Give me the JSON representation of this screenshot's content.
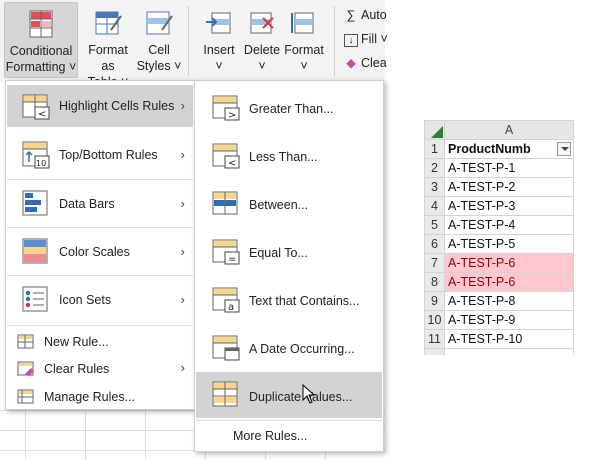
{
  "ribbon": {
    "buttons": [
      {
        "label": "Conditional Formatting",
        "icon": "conditional-formatting-icon",
        "pressed": true
      },
      {
        "label": "Format as Table",
        "icon": "format-as-table-icon"
      },
      {
        "label": "Cell Styles",
        "icon": "cell-styles-icon"
      },
      {
        "label": "Insert",
        "icon": "insert-cells-icon"
      },
      {
        "label": "Delete",
        "icon": "delete-cells-icon"
      },
      {
        "label": "Format",
        "icon": "format-cells-icon"
      }
    ],
    "editing": {
      "autosum": "Auto",
      "fill": "Fill",
      "clear": "Clea"
    }
  },
  "menu1": {
    "items": [
      {
        "label": "Highlight Cells Rules",
        "icon": "highlight-cells-icon",
        "highlighted": true,
        "submenu": true
      },
      {
        "label": "Top/Bottom Rules",
        "icon": "top-bottom-icon",
        "submenu": true
      },
      {
        "label": "Data Bars",
        "icon": "data-bars-icon",
        "submenu": true
      },
      {
        "label": "Color Scales",
        "icon": "color-scales-icon",
        "submenu": true
      },
      {
        "label": "Icon Sets",
        "icon": "icon-sets-icon",
        "submenu": true
      }
    ],
    "small_items": [
      {
        "label": "New Rule...",
        "icon": "new-rule-icon"
      },
      {
        "label": "Clear Rules",
        "icon": "clear-rules-icon",
        "submenu": true
      },
      {
        "label": "Manage Rules...",
        "icon": "manage-rules-icon"
      }
    ]
  },
  "menu2": {
    "items": [
      {
        "label": "Greater Than...",
        "icon": "greater-than-icon"
      },
      {
        "label": "Less Than...",
        "icon": "less-than-icon"
      },
      {
        "label": "Between...",
        "icon": "between-icon"
      },
      {
        "label": "Equal To...",
        "icon": "equal-to-icon"
      },
      {
        "label": "Text that Contains...",
        "icon": "text-contains-icon"
      },
      {
        "label": "A Date Occurring...",
        "icon": "date-occurring-icon"
      },
      {
        "label": "Duplicate Values...",
        "icon": "duplicate-values-icon",
        "highlighted": true
      }
    ],
    "more_rules": "More Rules..."
  },
  "sheet": {
    "column": "A",
    "header": "ProductNumb",
    "rows": [
      {
        "num": "1"
      },
      {
        "num": "2",
        "value": "A-TEST-P-1"
      },
      {
        "num": "3",
        "value": "A-TEST-P-2"
      },
      {
        "num": "4",
        "value": "A-TEST-P-3"
      },
      {
        "num": "5",
        "value": "A-TEST-P-4"
      },
      {
        "num": "6",
        "value": "A-TEST-P-5"
      },
      {
        "num": "7",
        "value": "A-TEST-P-6",
        "duplicate": true
      },
      {
        "num": "8",
        "value": "A-TEST-P-6",
        "duplicate": true
      },
      {
        "num": "9",
        "value": "A-TEST-P-8"
      },
      {
        "num": "10",
        "value": "A-TEST-P-9"
      },
      {
        "num": "11",
        "value": "A-TEST-P-10"
      }
    ],
    "duplicate_fill": "#ffc7ce",
    "duplicate_text": "#9c0006"
  }
}
